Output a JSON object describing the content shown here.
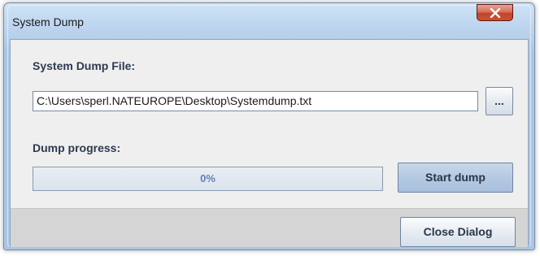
{
  "window": {
    "title": "System Dump"
  },
  "form": {
    "file_label": "System Dump File:",
    "file_path": "C:\\Users\\sperl.NATEUROPE\\Desktop\\Systemdump.txt",
    "browse_label": "...",
    "progress_label": "Dump progress:",
    "progress_percent": 0,
    "progress_text": "0%",
    "start_label": "Start dump"
  },
  "footer": {
    "close_label": "Close Dialog"
  },
  "icons": {
    "window_close": "close-icon"
  }
}
